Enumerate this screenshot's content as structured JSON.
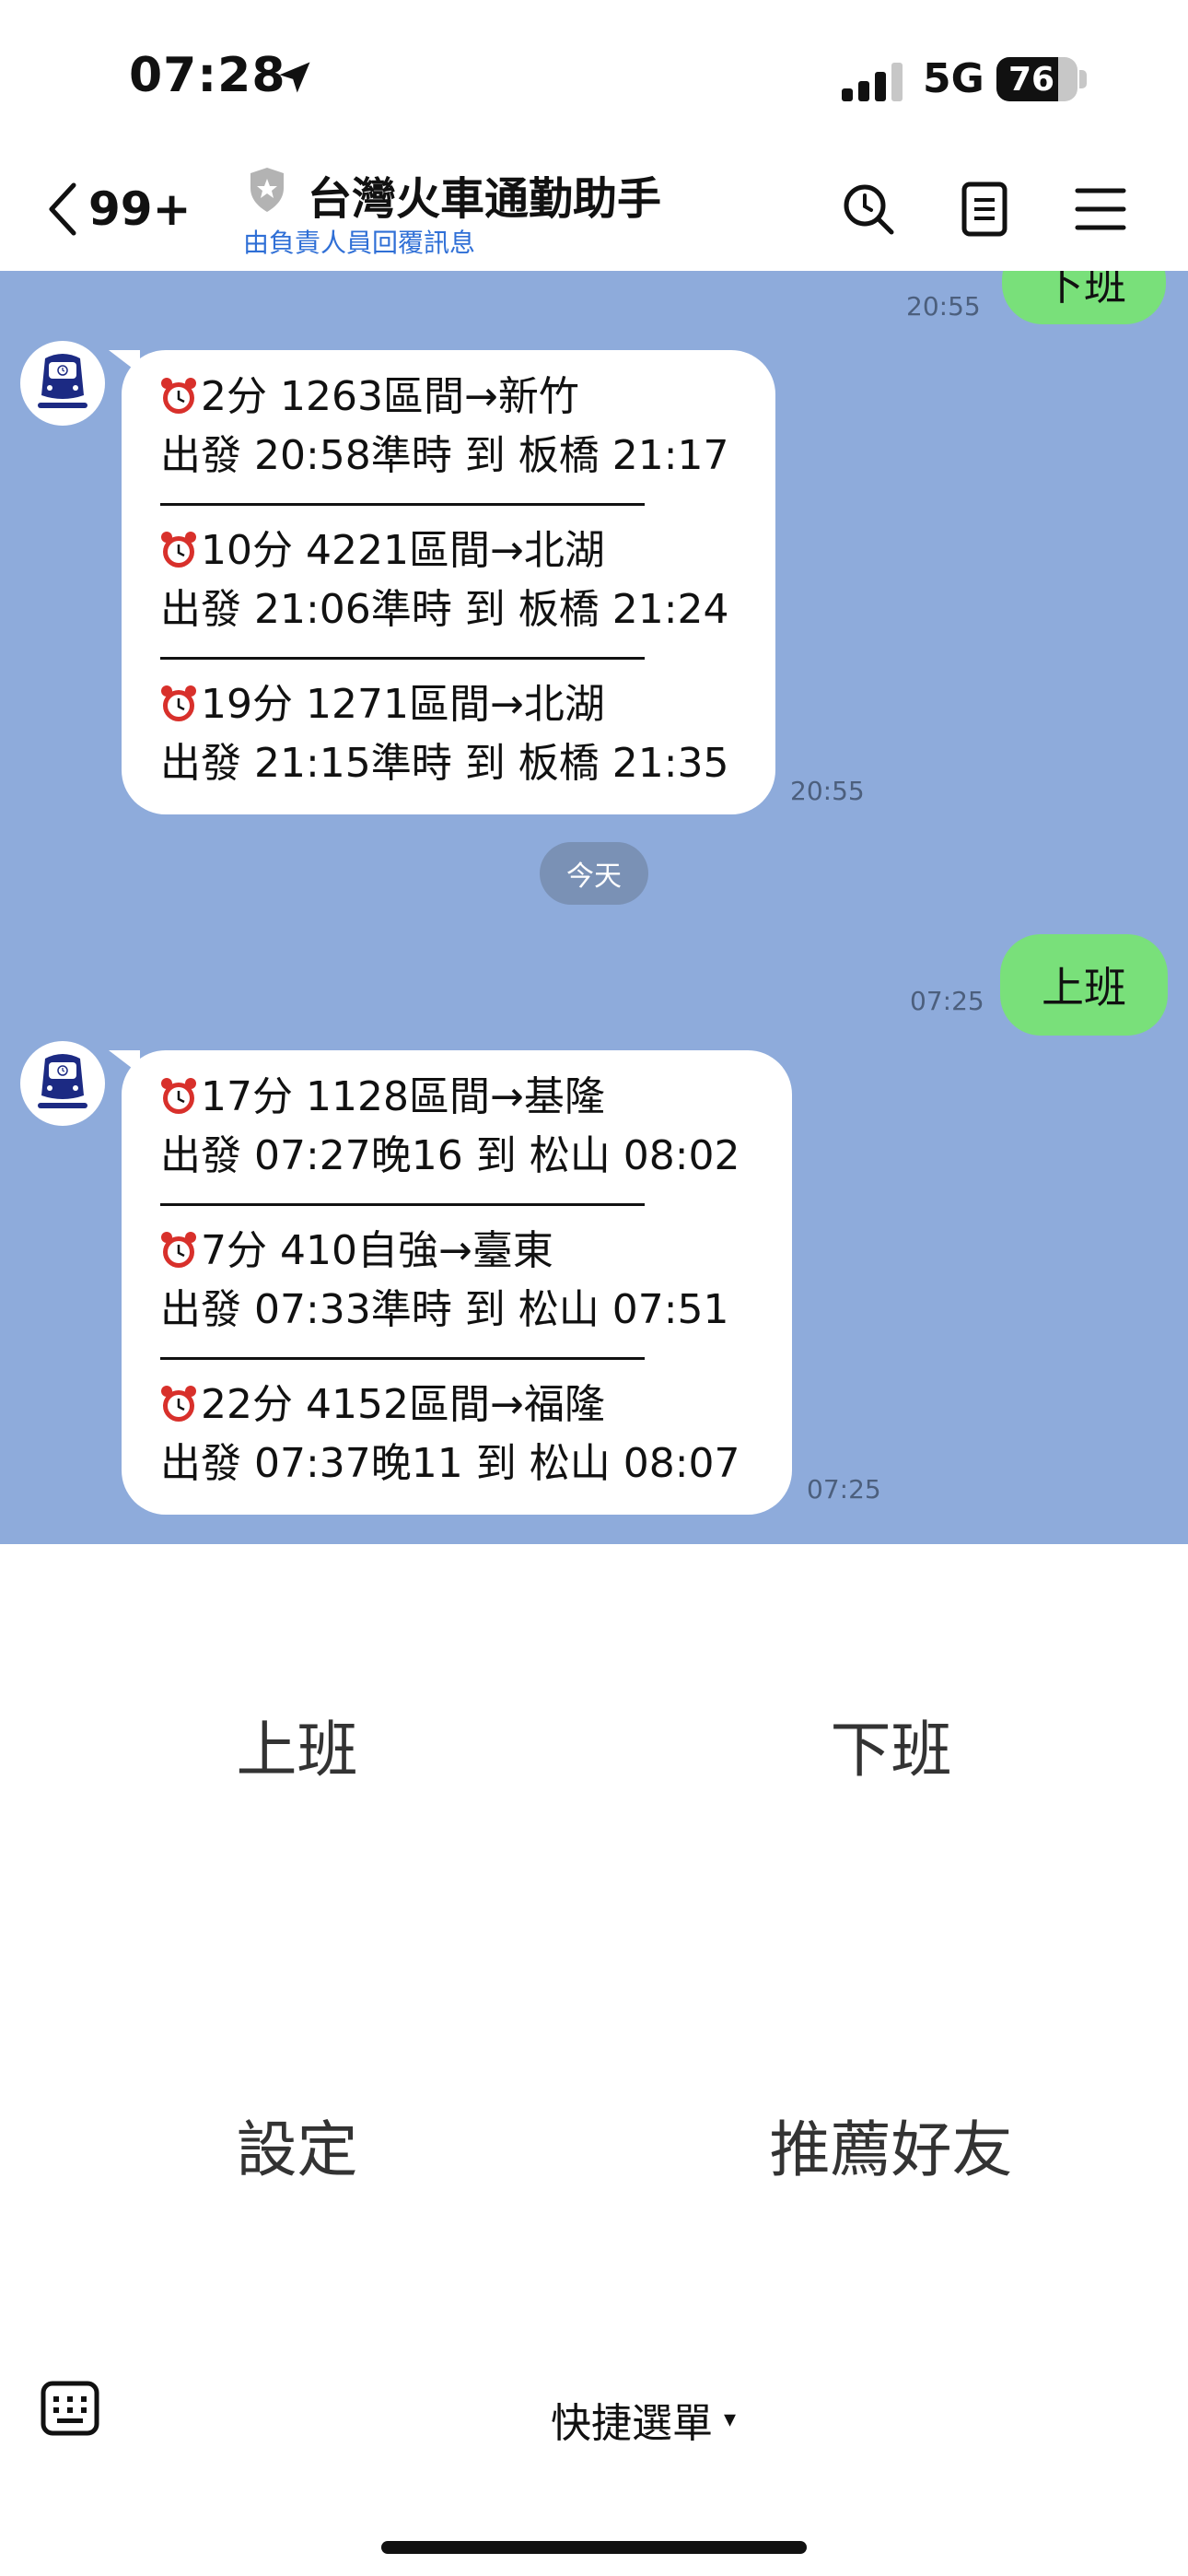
{
  "status_bar": {
    "time": "07:28",
    "network": "5G",
    "battery": "76",
    "battery_level_percent": 76,
    "icons": [
      "location-arrow-icon",
      "cellular-signal-icon",
      "battery-icon"
    ]
  },
  "header": {
    "back_count": "99+",
    "title": "台灣火車通勤助手",
    "subtitle": "由負責人員回覆訊息",
    "icons": [
      "back-chevron-icon",
      "verified-shield-icon",
      "search-icon",
      "notes-icon",
      "menu-icon"
    ]
  },
  "chat": {
    "colors": {
      "background": "#8eabdb",
      "user_bubble": "#79e07a",
      "bot_bubble": "#ffffff"
    },
    "messages": [
      {
        "sender": "user",
        "text": "下班",
        "time": "20:55"
      },
      {
        "sender": "bot",
        "time": "20:55",
        "trains": [
          {
            "line1": "2分 1263區間→新竹",
            "line2": "出發 20:58準時 到 板橋 21:17"
          },
          {
            "line1": "10分 4221區間→北湖",
            "line2": "出發 21:06準時 到 板橋 21:24"
          },
          {
            "line1": "19分 1271區間→北湖",
            "line2": "出發 21:15準時 到 板橋 21:35"
          }
        ]
      },
      {
        "sender": "system",
        "text": "今天"
      },
      {
        "sender": "user",
        "text": "上班",
        "time": "07:25"
      },
      {
        "sender": "bot",
        "time": "07:25",
        "trains": [
          {
            "line1": "17分 1128區間→基隆",
            "line2": "出發 07:27晚16 到 松山 08:02"
          },
          {
            "line1": "7分 410自強→臺東",
            "line2": "出發 07:33準時 到 松山 07:51"
          },
          {
            "line1": "22分 4152區間→福隆",
            "line2": "出發 07:37晚11 到 松山 08:07"
          }
        ]
      }
    ]
  },
  "quick_menu": {
    "items": [
      {
        "label": "上班"
      },
      {
        "label": "下班"
      },
      {
        "label": "設定"
      },
      {
        "label": "推薦好友"
      }
    ]
  },
  "bottom_bar": {
    "toggle_label": "快捷選單",
    "caret": "▾",
    "icons": [
      "keyboard-icon"
    ]
  }
}
